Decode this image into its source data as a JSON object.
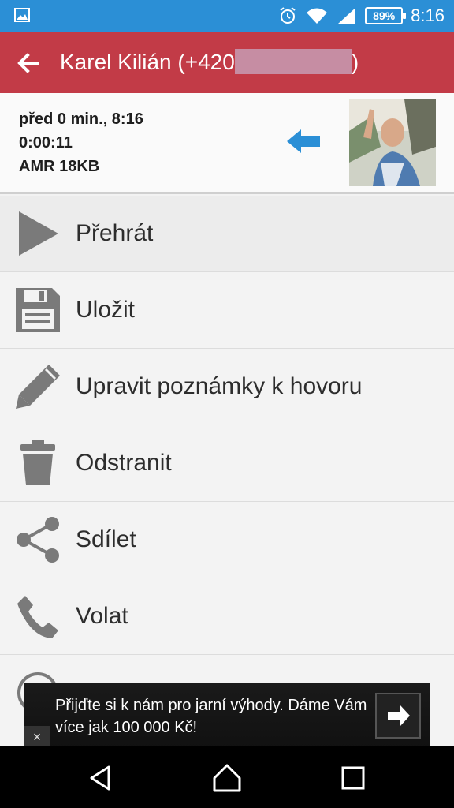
{
  "status_bar": {
    "time": "8:16",
    "battery_percent": "89%",
    "icons": [
      "image-icon",
      "alarm-icon",
      "wifi-icon",
      "signal-icon",
      "battery-icon"
    ]
  },
  "app_bar": {
    "title_prefix": "Karel Kilián (+420",
    "title_suffix": ")"
  },
  "call_info": {
    "when": "před 0 min., 8:16",
    "duration": "0:00:11",
    "format": "AMR 18KB",
    "direction_icon": "incoming-arrow-icon"
  },
  "menu": {
    "items": [
      {
        "label": "Přehrát",
        "icon": "play-icon"
      },
      {
        "label": "Uložit",
        "icon": "save-icon"
      },
      {
        "label": "Upravit poznámky k hovoru",
        "icon": "pencil-icon"
      },
      {
        "label": "Odstranit",
        "icon": "trash-icon"
      },
      {
        "label": "Sdílet",
        "icon": "share-icon"
      },
      {
        "label": "Volat",
        "icon": "phone-icon"
      }
    ]
  },
  "ad": {
    "text": "Přijďte si k nám pro jarní výhody. Dáme Vám více jak 100 000 Kč!",
    "close": "×"
  },
  "colors": {
    "status_bar": "#2b8fd6",
    "app_bar": "#c23b47",
    "arrow": "#2b8fd6",
    "icon_gray": "#7a7a7a"
  }
}
